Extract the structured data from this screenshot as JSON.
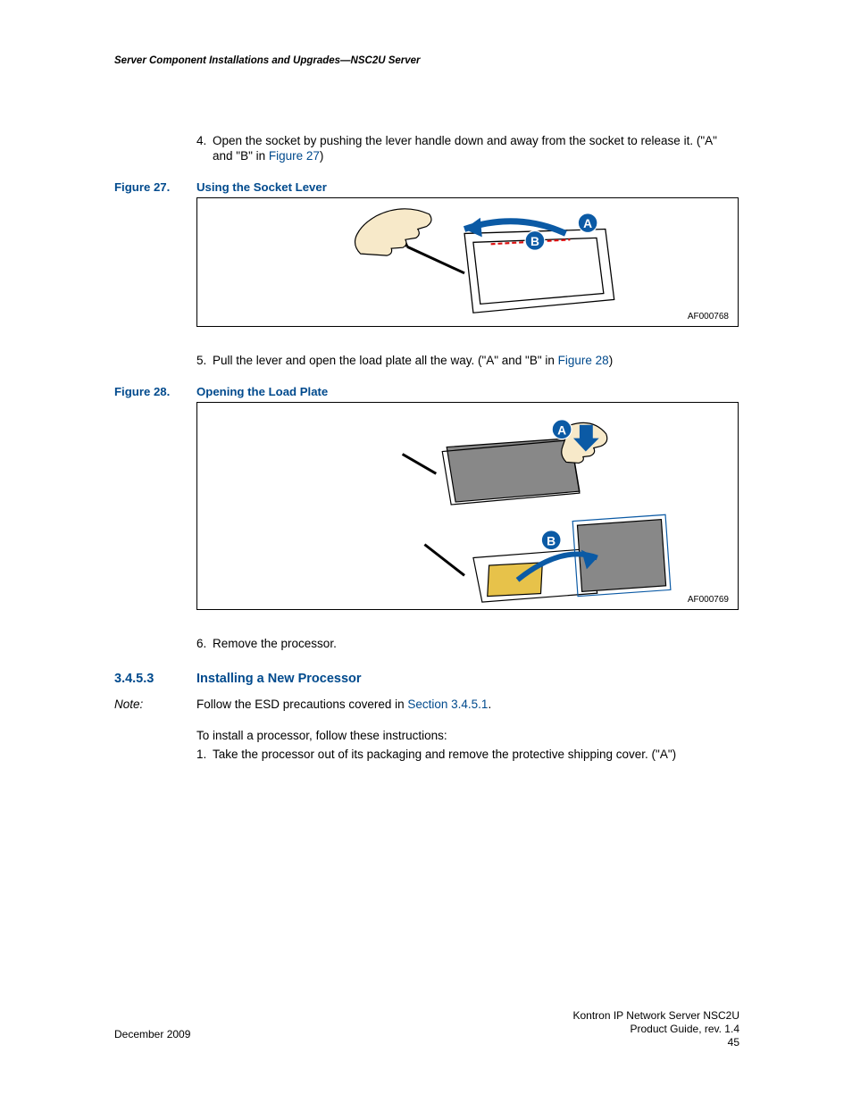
{
  "header": {
    "running": "Server Component Installations and Upgrades—NSC2U Server"
  },
  "steps": {
    "s4_num": "4.",
    "s4_a": "Open the socket by pushing the lever handle down and away from the socket to release it. (\"A\" and \"B\" in ",
    "s4_link": "Figure 27",
    "s4_b": ")",
    "s5_num": "5.",
    "s5_a": "Pull the lever and open the load plate all the way. (\"A\" and \"B\" in ",
    "s5_link": "Figure 28",
    "s5_b": ")",
    "s6_num": "6.",
    "s6": "Remove the processor."
  },
  "fig27": {
    "label": "Figure 27.",
    "title": "Using the Socket Lever",
    "af": "AF000768",
    "badgeA": "A",
    "badgeB": "B"
  },
  "fig28": {
    "label": "Figure 28.",
    "title": "Opening the Load Plate",
    "af": "AF000769",
    "badgeA": "A",
    "badgeB": "B"
  },
  "section": {
    "num": "3.4.5.3",
    "title": "Installing a New Processor"
  },
  "note": {
    "label": "Note:",
    "body_a": "Follow the ESD precautions covered in ",
    "body_link": "Section 3.4.5.1",
    "body_b": "."
  },
  "para1": "To install a processor, follow these instructions:",
  "step1": {
    "num": "1.",
    "text": "Take the processor out of its packaging and remove the protective shipping cover. (\"A\")"
  },
  "footer": {
    "date": "December 2009",
    "prod1": "Kontron IP Network Server NSC2U",
    "prod2": "Product Guide, rev. 1.4",
    "page": "45"
  }
}
